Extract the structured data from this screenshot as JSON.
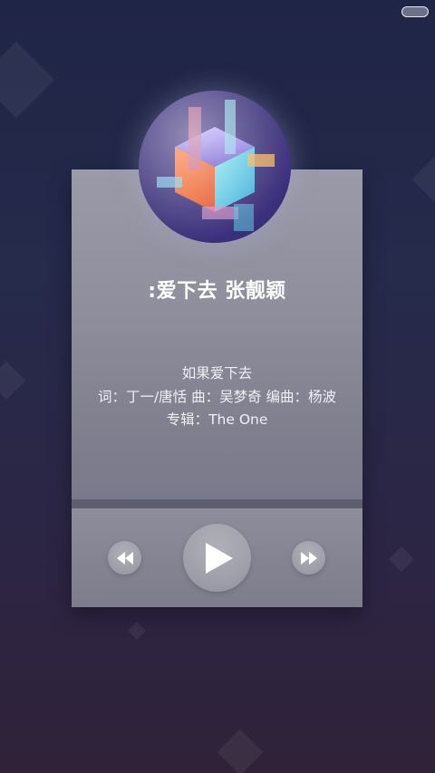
{
  "song": {
    "title": ":爱下去 张靓颖",
    "subtitle": "如果爱下去",
    "credits": "词：丁一/唐恬 曲：吴梦奇 编曲：杨波",
    "album": "专辑：The One"
  },
  "controls": {
    "prev_icon": "rewind-icon",
    "play_icon": "play-icon",
    "next_icon": "fast-forward-icon"
  },
  "colors": {
    "background_top": "#1f2546",
    "background_bottom": "#2f2238",
    "card": "#8f8f9e"
  }
}
